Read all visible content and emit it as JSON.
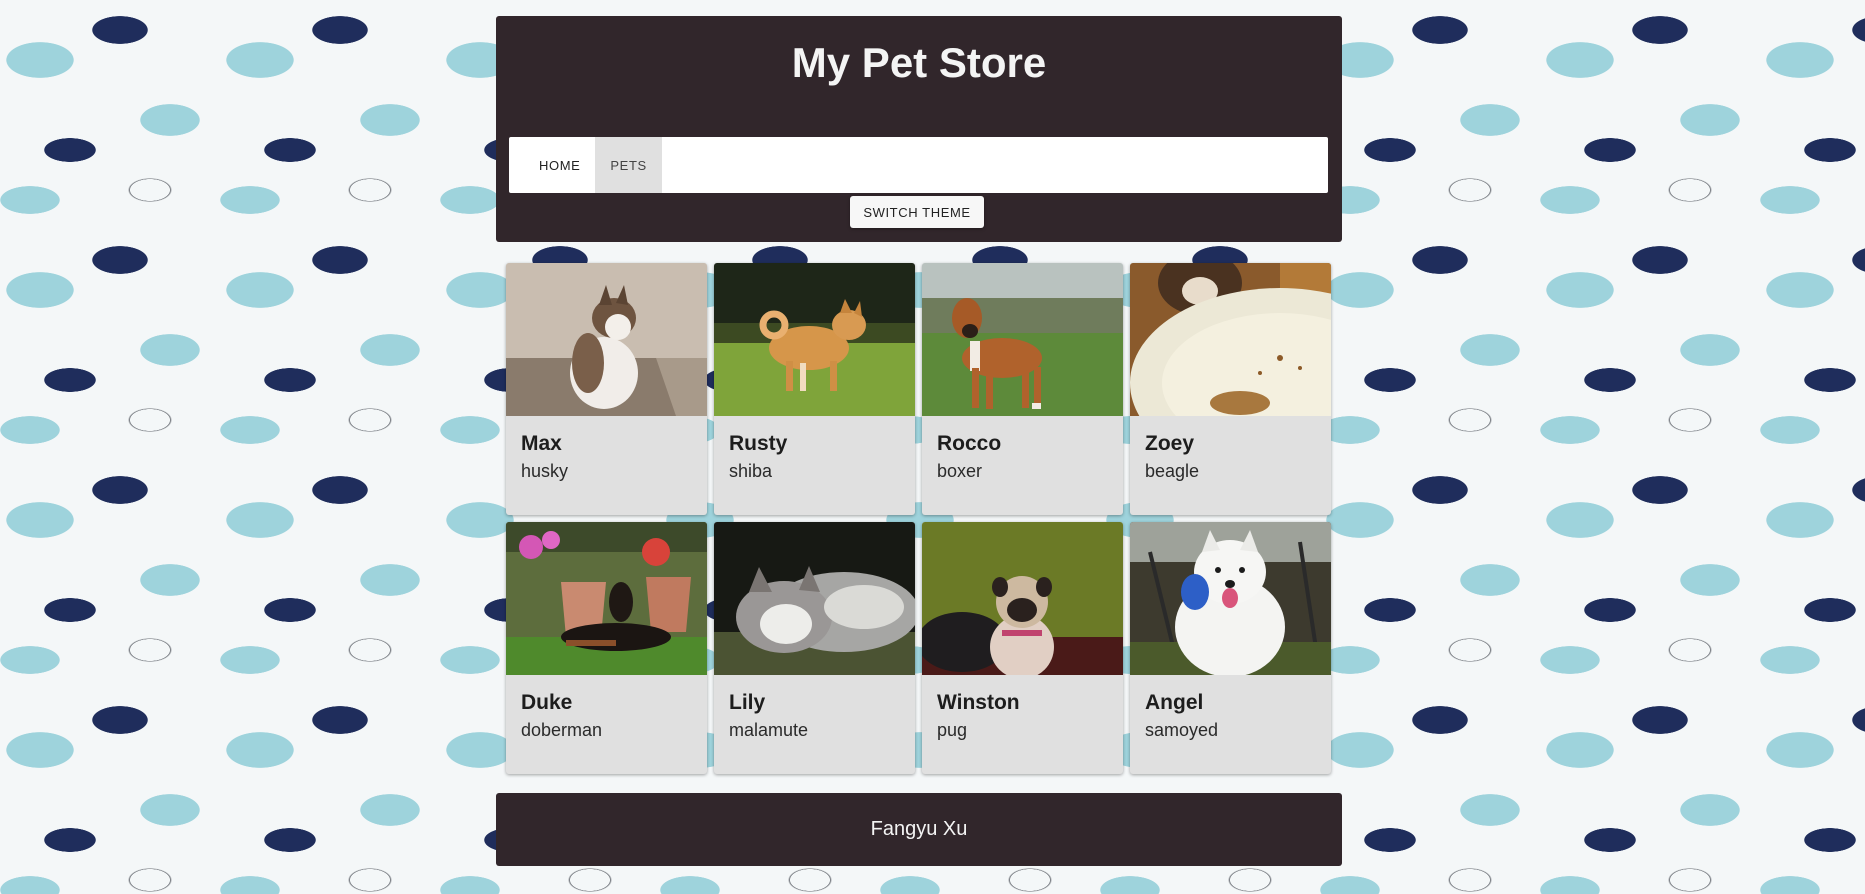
{
  "header": {
    "title": "My Pet Store",
    "nav": [
      {
        "label": "HOME",
        "active": false
      },
      {
        "label": "PETS",
        "active": true
      }
    ],
    "theme_button": "SWITCH THEME"
  },
  "pets": [
    {
      "name": "Max",
      "breed": "husky"
    },
    {
      "name": "Rusty",
      "breed": "shiba"
    },
    {
      "name": "Rocco",
      "breed": "boxer"
    },
    {
      "name": "Zoey",
      "breed": "beagle"
    },
    {
      "name": "Duke",
      "breed": "doberman"
    },
    {
      "name": "Lily",
      "breed": "malamute"
    },
    {
      "name": "Winston",
      "breed": "pug"
    },
    {
      "name": "Angel",
      "breed": "samoyed"
    }
  ],
  "footer": {
    "text": "Fangyu Xu"
  },
  "colors": {
    "header_bg": "#31262b",
    "card_bg": "#e0e0e0",
    "active_tab_bg": "#e0e0e0"
  }
}
